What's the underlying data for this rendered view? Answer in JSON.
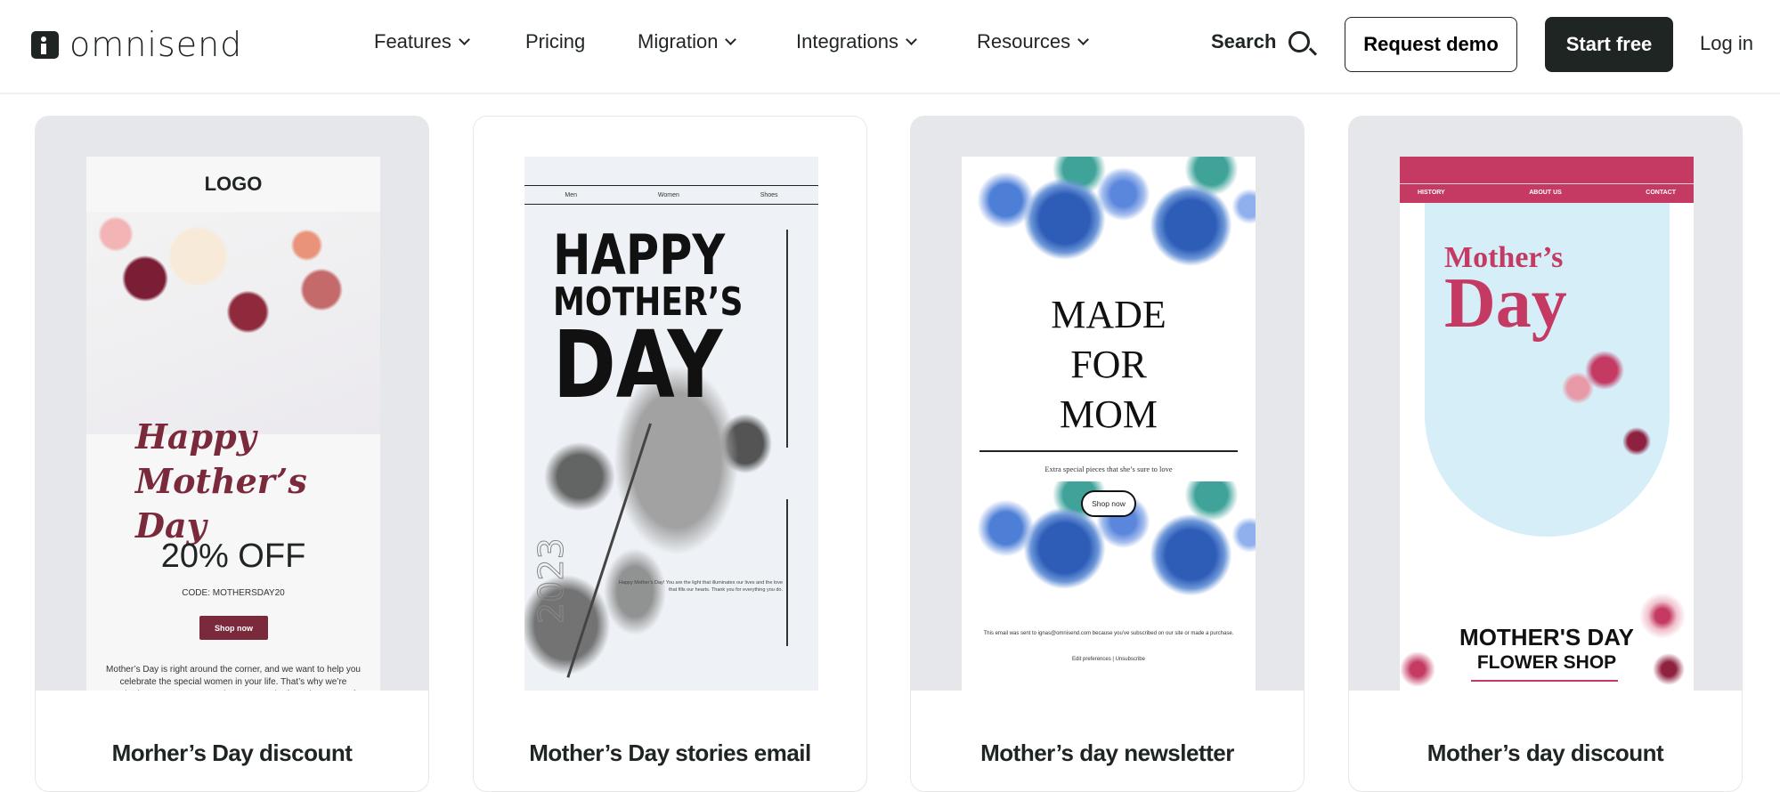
{
  "header": {
    "brand": "omnisend",
    "nav": [
      {
        "label": "Features",
        "dropdown": true
      },
      {
        "label": "Pricing",
        "dropdown": false
      },
      {
        "label": "Migration",
        "dropdown": true
      },
      {
        "label": "Integrations",
        "dropdown": true
      },
      {
        "label": "Resources",
        "dropdown": true
      }
    ],
    "search_label": "Search",
    "request_demo": "Request demo",
    "start_free": "Start free",
    "login": "Log in",
    "colors": {
      "primary_dark": "#1f2523",
      "card_bg": "#e5e7ea"
    }
  },
  "cards": [
    {
      "title": "Morher’s Day discount",
      "preview": {
        "logo": "LOGO",
        "headline": "Happy Mother’s Day",
        "offer": "20% OFF",
        "code": "CODE: MOTHERSDAY20",
        "button": "Shop now",
        "body": "Mother’s Day is right around the corner, and we want to help you celebrate the special women in your life. That’s why we’re excited to announce our Mother’s Day Sale, featuring some of our most"
      }
    },
    {
      "title": "Mother’s Day stories email",
      "preview": {
        "nav": [
          "Men",
          "Women",
          "Shoes"
        ],
        "headline_1": "HAPPY",
        "headline_2": "MOTHER’S",
        "headline_3": "DAY",
        "year": "2023",
        "story": "Happy Mother’s Day! You are the light that illuminates our lives and the love that fills our hearts. Thank you for everything you do."
      }
    },
    {
      "title": "Mother’s day newsletter",
      "preview": {
        "headline": [
          "MADE",
          "FOR",
          "MOM"
        ],
        "subtitle": "Extra special pieces that she’s sure to love",
        "button": "Shop now",
        "footer": "This email was sent to ignas@omnisend.com because you've subscribed on our site or made a purchase.",
        "links": "Edit preferences | Unsubscribe"
      }
    },
    {
      "title": "Mother’s day discount",
      "preview": {
        "nav": [
          "HISTORY",
          "ABOUT US",
          "CONTACT"
        ],
        "headline_1": "Mother’s",
        "headline_2": "Day",
        "title_1": "MOTHER'S DAY",
        "title_2": "FLOWER SHOP",
        "accent": "#c43a63"
      }
    }
  ]
}
